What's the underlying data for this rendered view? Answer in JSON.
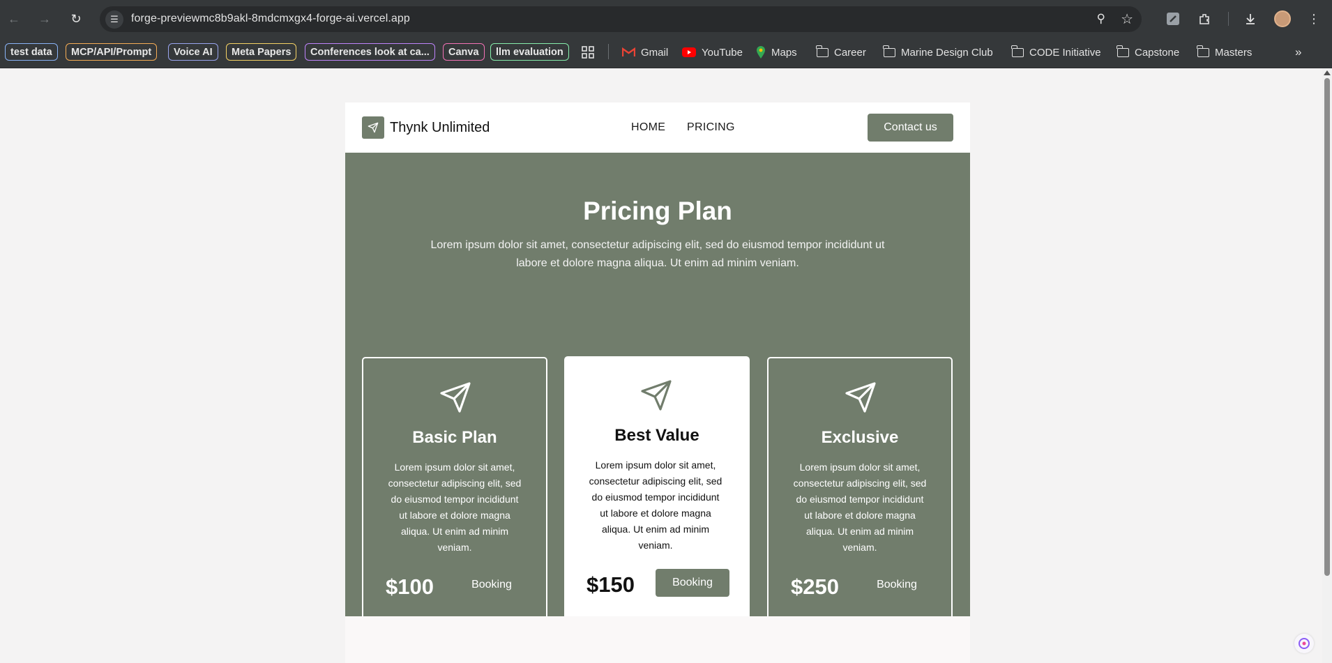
{
  "browser": {
    "url": "forge-previewmc8b9akl-8mdcmxgx4-forge-ai.vercel.app",
    "bookmark_chips": [
      {
        "label": "test data",
        "color": "#8ab4f8"
      },
      {
        "label": "MCP/API/Prompt",
        "color": "#f6ad55"
      },
      {
        "label": "Voice AI",
        "color": "#9aa6f0"
      },
      {
        "label": "Meta Papers",
        "color": "#f6d365"
      },
      {
        "label": "Conferences look at ca...",
        "color": "#c084fc"
      },
      {
        "label": "Canva",
        "color": "#f472b6"
      },
      {
        "label": "llm evaluation",
        "color": "#86efac"
      }
    ],
    "bookmarks": [
      {
        "label": "Gmail",
        "icon": "gmail-icon"
      },
      {
        "label": "YouTube",
        "icon": "youtube-icon"
      },
      {
        "label": "Maps",
        "icon": "maps-icon"
      },
      {
        "label": "Career",
        "icon": "folder-icon"
      },
      {
        "label": "Marine Design Club",
        "icon": "folder-icon"
      },
      {
        "label": "CODE Initiative",
        "icon": "folder-icon"
      },
      {
        "label": "Capstone",
        "icon": "folder-icon"
      },
      {
        "label": "Masters",
        "icon": "folder-icon"
      }
    ]
  },
  "site": {
    "brand": "Thynk Unlimited",
    "nav": {
      "home": "HOME",
      "pricing": "PRICING"
    },
    "contact_label": "Contact us",
    "accent_color": "#717d6c"
  },
  "pricing": {
    "title": "Pricing Plan",
    "lead": "Lorem ipsum dolor sit amet, consectetur adipiscing elit, sed do eiusmod tempor incididunt ut labore et dolore magna aliqua. Ut enim ad minim veniam.",
    "plans": [
      {
        "name": "Basic Plan",
        "description": "Lorem ipsum dolor sit amet, consectetur adipiscing elit, sed do eiusmod tempor incididunt ut labore et dolore magna aliqua. Ut enim ad minim veniam.",
        "price": "$100",
        "button": "Booking"
      },
      {
        "name": "Best Value",
        "description": "Lorem ipsum dolor sit amet, consectetur adipiscing elit, sed do eiusmod tempor incididunt ut labore et dolore magna aliqua. Ut enim ad minim veniam.",
        "price": "$150",
        "button": "Booking"
      },
      {
        "name": "Exclusive",
        "description": "Lorem ipsum dolor sit amet, consectetur adipiscing elit, sed do eiusmod tempor incididunt ut labore et dolore magna aliqua. Ut enim ad minim veniam.",
        "price": "$250",
        "button": "Booking"
      }
    ]
  }
}
